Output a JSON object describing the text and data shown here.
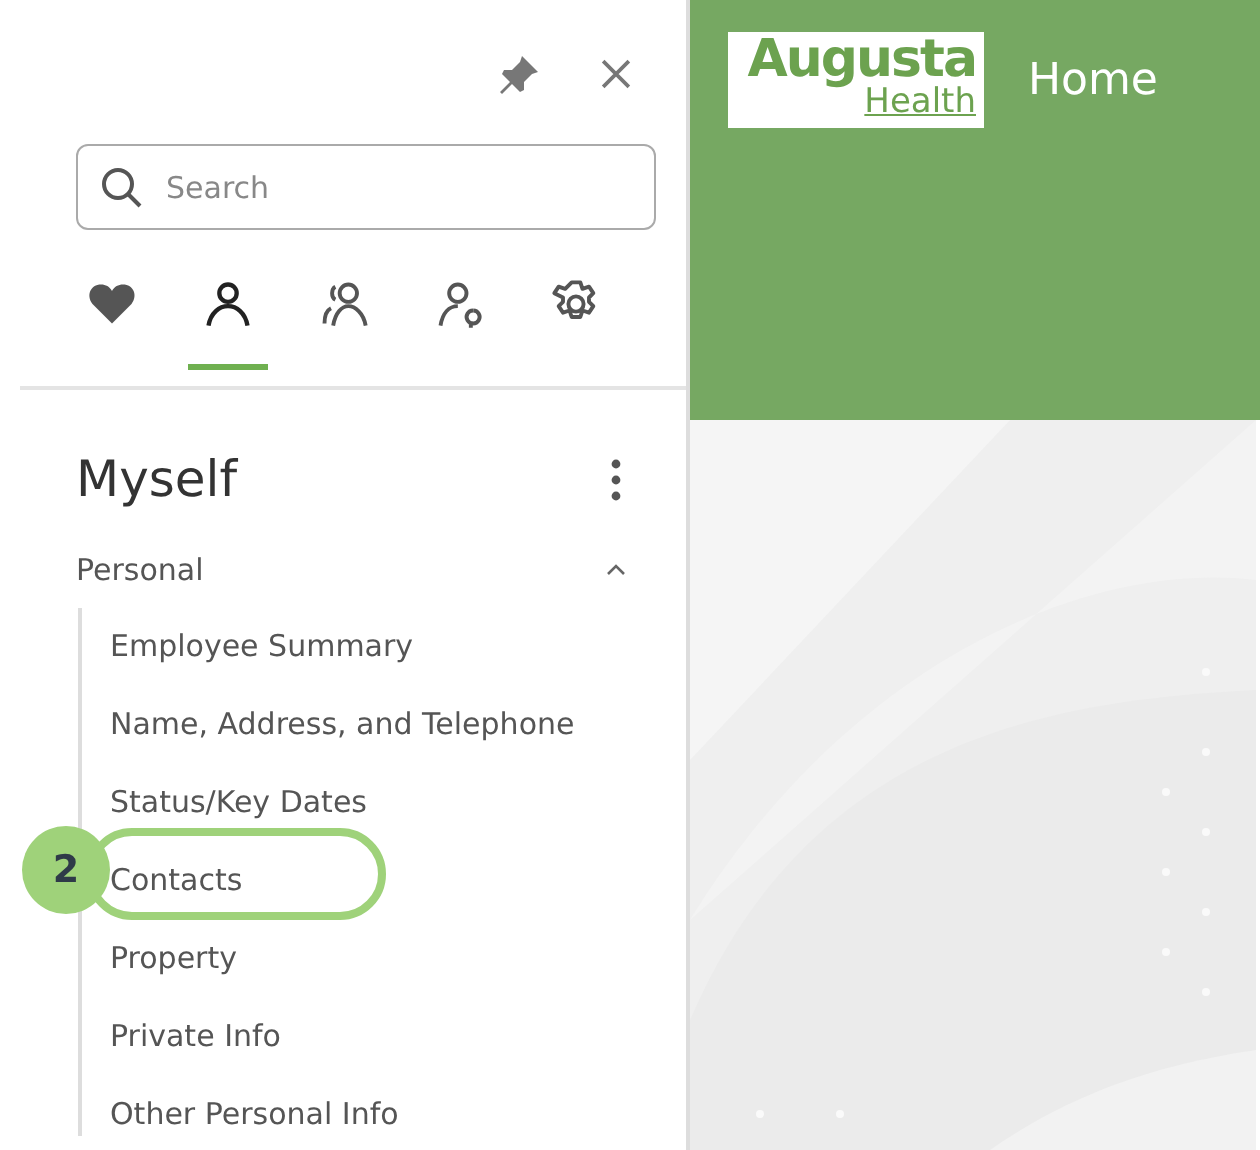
{
  "panel": {
    "search": {
      "placeholder": "Search"
    },
    "tabs": [
      {
        "kind": "heart",
        "selected": false
      },
      {
        "kind": "person",
        "selected": true
      },
      {
        "kind": "people",
        "selected": false
      },
      {
        "kind": "person-key",
        "selected": false
      },
      {
        "kind": "gear",
        "selected": false
      }
    ],
    "title": "Myself",
    "section": {
      "label": "Personal",
      "expanded": true,
      "items": [
        {
          "label": "Employee Summary",
          "highlighted": false
        },
        {
          "label": "Name, Address, and Telephone",
          "highlighted": false
        },
        {
          "label": "Status/Key Dates",
          "highlighted": false
        },
        {
          "label": "Contacts",
          "highlighted": true
        },
        {
          "label": "Property",
          "highlighted": false
        },
        {
          "label": "Private Info",
          "highlighted": false
        },
        {
          "label": "Other Personal Info",
          "highlighted": false
        }
      ]
    }
  },
  "callout": {
    "number": "2"
  },
  "header": {
    "logo": {
      "line_1": "Augusta",
      "line_2": "Health"
    },
    "title": "Home"
  }
}
